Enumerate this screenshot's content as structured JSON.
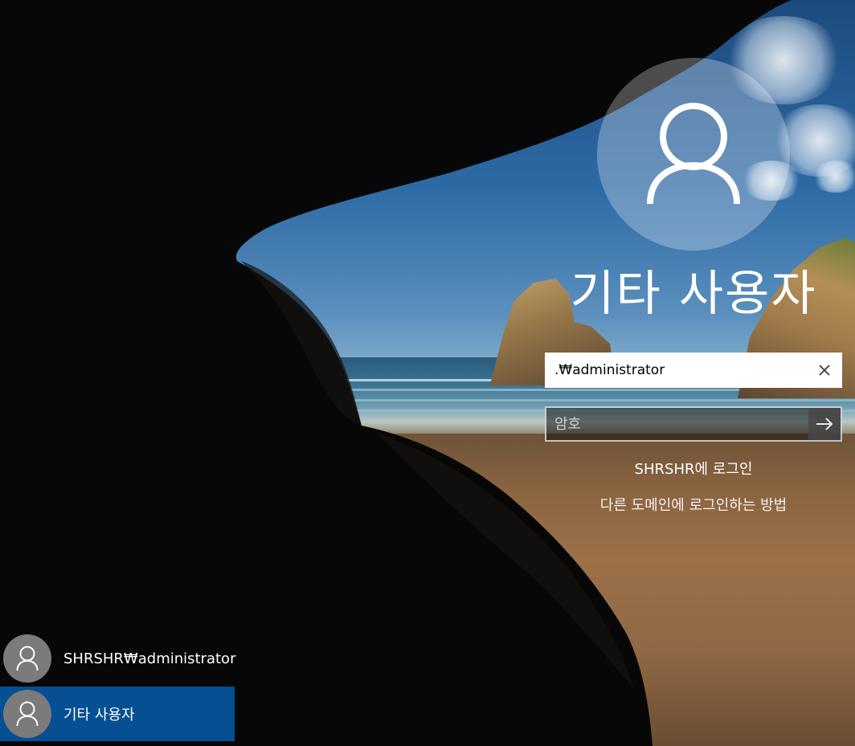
{
  "login": {
    "user_title": "기타 사용자",
    "username_value": ".₩administrator",
    "password_placeholder": "암호",
    "sign_in_to": "SHRSHR에 로그인",
    "other_domain_link": "다른 도메인에 로그인하는 방법"
  },
  "user_list": [
    {
      "name": "SHRSHR₩administrator",
      "selected": false
    },
    {
      "name": "기타 사용자",
      "selected": true
    }
  ],
  "icons": {
    "avatar": "person-outline-icon",
    "clear": "close-icon",
    "submit": "arrow-right-icon"
  },
  "colors": {
    "selected_user": "#054f92",
    "avatar_gray": "#7b7b7b"
  }
}
